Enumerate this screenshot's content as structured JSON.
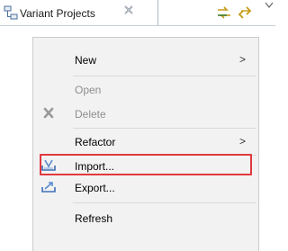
{
  "view": {
    "tab_title": "Variant Projects",
    "tab_icon": "project-hierarchy-icon",
    "close_icon": "close-icon",
    "toolbar": [
      {
        "icon": "sync-icon"
      },
      {
        "icon": "link-with-editor-icon"
      }
    ],
    "view_menu_icon": "view-menu-chevron-icon"
  },
  "context_menu": {
    "items": [
      {
        "label": "New",
        "enabled": true,
        "submenu": ">"
      },
      {
        "label": "Open",
        "enabled": false
      },
      {
        "label": "Delete",
        "enabled": false,
        "icon": "delete-icon"
      },
      {
        "label": "Refactor",
        "enabled": true,
        "submenu": ">"
      },
      {
        "label": "Import...",
        "enabled": true,
        "icon": "import-icon",
        "highlighted": true
      },
      {
        "label": "Export...",
        "enabled": true,
        "icon": "export-icon"
      },
      {
        "label": "Refresh",
        "enabled": true
      }
    ],
    "highlight_color": "#e0393e"
  }
}
